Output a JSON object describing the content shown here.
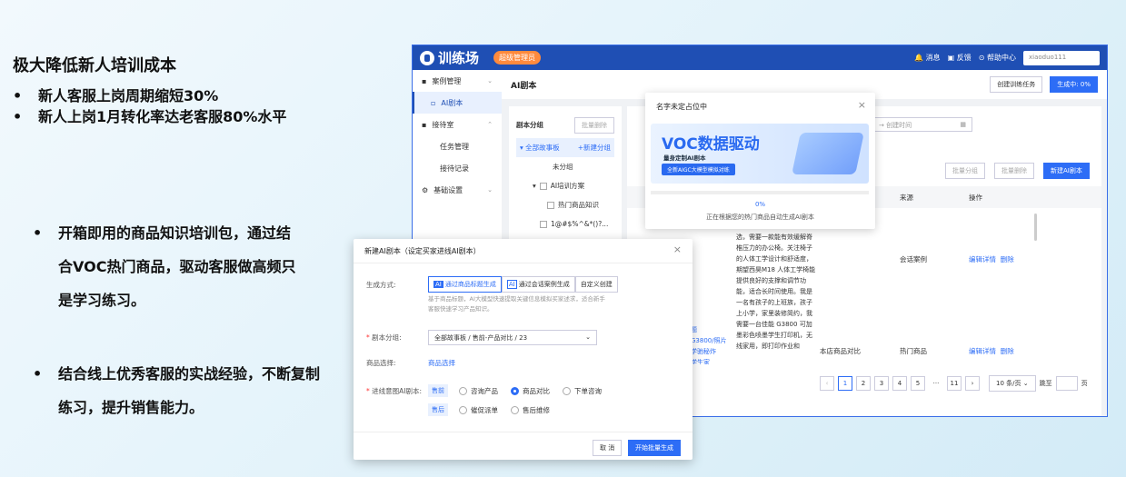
{
  "slide": {
    "heading": "极大降低新人培训成本",
    "bullets": [
      "新人客服上岗周期缩短30%",
      "新人上岗1月转化率达老客服80%水平"
    ],
    "block1": "开箱即用的商品知识培训包，通过结合VOC热门商品，驱动客服做高频只是学习练习。",
    "block2": "结合线上优秀客服的实战经验，不断复制练习，提升销售能力。",
    "bullet_glyph": "•"
  },
  "app": {
    "logo": "训练场",
    "badge": "超级管理员",
    "top": {
      "msg": "消息",
      "feedback": "反馈",
      "help": "帮助中心",
      "user": "xiaoduo111"
    },
    "sidebar": {
      "case_mgmt": "案例管理",
      "ai_script": "AI剧本",
      "reception": "接待室",
      "task_mgmt": "任务管理",
      "reception_log": "接待记录",
      "settings": "基础设置"
    },
    "page_title": "AI剧本",
    "create_task": "创建训练任务",
    "generating": "生成中: 0%",
    "tree": {
      "title": "剧本分组",
      "batch_delete": "批量删除",
      "all": "全部故事板",
      "new_group": "+新建分组",
      "ungrouped": "未分组",
      "ai_plan": "AI培训方案",
      "hot_items": "热门商品知识",
      "item1": "1@#$%^&*()?...",
      "item2": "? ? ?"
    },
    "table": {
      "create_time": "创建时间",
      "batch_group": "批量分组",
      "batch_delete": "批量删除",
      "new_script": "新建AI剧本",
      "col_source": "来源",
      "col_action": "操作",
      "desc_text": "选，需要一款能有效缓解脊椎压力的办公椅。关注椅子的人体工学设计和舒适度，期望西昊M18 人体工学椅能提供良好的支撑和调节功能，适合长时间使用。我是一名有孩子的上班族，孩子上小学，家里装修简约，我需要一台佳能 G3800 可加墨彩色喷墨学生打印机，无线家用，即打印作业和",
      "left_frag": "题\nG3800/照片\n学驰秘炸\n学生家",
      "src1": "会话案例",
      "src2a": "本店商品对比",
      "src2b": "热门商品",
      "action_edit": "编辑详情",
      "action_del": "删除"
    },
    "pagination": {
      "pages": [
        "1",
        "2",
        "3",
        "4",
        "5",
        "···",
        "11"
      ],
      "per_page": "10 条/页",
      "jump": "跳至",
      "page_unit": "页"
    }
  },
  "progress_dialog": {
    "title": "名字未定占位中",
    "banner_title": "VOC数据驱动",
    "banner_sub": "量身定制AI剧本",
    "banner_tag": "全新AIGC大模型模拟对练",
    "percent": "0%",
    "status": "正在根据您的热门商品自动生成AI剧本",
    "progress": 0
  },
  "new_dialog": {
    "title": "新建AI剧本（设定买家进线AI剧本）",
    "gen_label": "生成方式:",
    "opt1": "通过商品标题生成",
    "opt2": "通过会话案例生成",
    "opt3": "自定义创建",
    "hint": "基于商品标题，AI大模型快速提取关键信息模拟买家述求，适合新手客服快速学习产品知识。",
    "group_label": "剧本分组:",
    "group_value": "全部故事板 / 售前-产品对比 / 23",
    "item_label": "商品选择:",
    "item_link": "商品选择",
    "intent_label": "进线意图AI剧本:",
    "pre_tag": "售前",
    "pre_opts": [
      "咨询产品",
      "商品对比",
      "下单咨询"
    ],
    "post_tag": "售后",
    "post_opts": [
      "催促派单",
      "售后维修"
    ],
    "cancel": "取 消",
    "start": "开始批量生成"
  }
}
